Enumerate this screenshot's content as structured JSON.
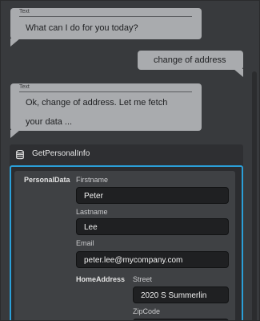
{
  "conversation": {
    "caption": "Text",
    "bot_message_1": "What can I do for you today?",
    "user_message": "change of address",
    "bot_message_2_line_1": "Ok, change of address. Let me fetch",
    "bot_message_2_line_2": "your data ..."
  },
  "tool": {
    "icon": "database-icon",
    "name": "GetPersonalInfo"
  },
  "form": {
    "section_label": "PersonalData",
    "firstname_label": "Firstname",
    "firstname_value": "Peter",
    "lastname_label": "Lastname",
    "lastname_value": "Lee",
    "email_label": "Email",
    "email_value": "peter.lee@mycompany.com",
    "home_address_label": "HomeAddress",
    "street_label": "Street",
    "street_value": "2020 S Summerlin",
    "zipcode_label": "ZipCode"
  },
  "colors": {
    "background": "#383a3d",
    "bubble": "#a9abae",
    "accent": "#2b9fd8"
  }
}
